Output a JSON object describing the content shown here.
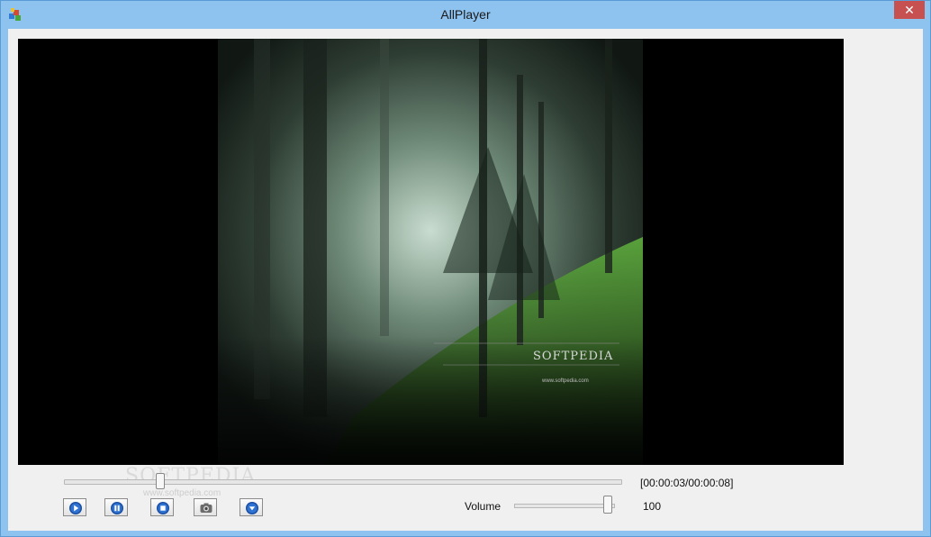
{
  "window": {
    "title": "AllPlayer",
    "close_glyph": "✕"
  },
  "video": {
    "overlay_brand": "SOFTPEDIA",
    "overlay_url": "www.softpedia.com",
    "overlay_small": "www.softpedia.com"
  },
  "controls": {
    "time": "[00:00:03/00:00:08]",
    "seek_fraction": 0.17,
    "buttons": [
      {
        "name": "play-icon"
      },
      {
        "name": "pause-icon"
      },
      {
        "name": "stop-icon"
      },
      {
        "name": "screenshot-icon"
      },
      {
        "name": "open-icon"
      }
    ],
    "volume_label": "Volume",
    "volume_value": "100"
  },
  "watermark": {
    "brand": "SOFTPEDIA",
    "url": "www.softpedia.com"
  },
  "colors": {
    "accent": "#1a4fa3",
    "titlebar": "#8ec2ef",
    "close": "#c75050"
  }
}
